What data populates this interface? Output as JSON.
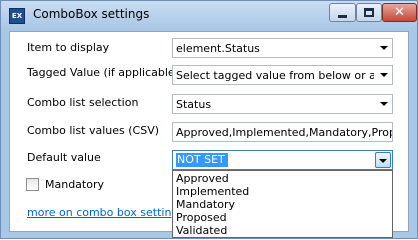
{
  "window": {
    "title": "ComboBox settings",
    "app_icon_text": "EX",
    "close_glyph": "✕"
  },
  "form": {
    "item_to_display": {
      "label": "Item to display",
      "value": "element.Status"
    },
    "tagged_value": {
      "label": "Tagged Value (if applicable)",
      "value": "Select tagged value from below or add new"
    },
    "combo_list_selection": {
      "label": "Combo list selection",
      "value": "Status"
    },
    "combo_list_values": {
      "label": "Combo list values (CSV)",
      "value": "Approved,Implemented,Mandatory,Proposed,Validated"
    },
    "default_value": {
      "label": "Default value",
      "value": "NOT SET",
      "options": [
        "Approved",
        "Implemented",
        "Mandatory",
        "Proposed",
        "Validated"
      ]
    },
    "mandatory": {
      "label": "Mandatory",
      "checked": false
    },
    "more_link": "more on combo box settings..."
  }
}
